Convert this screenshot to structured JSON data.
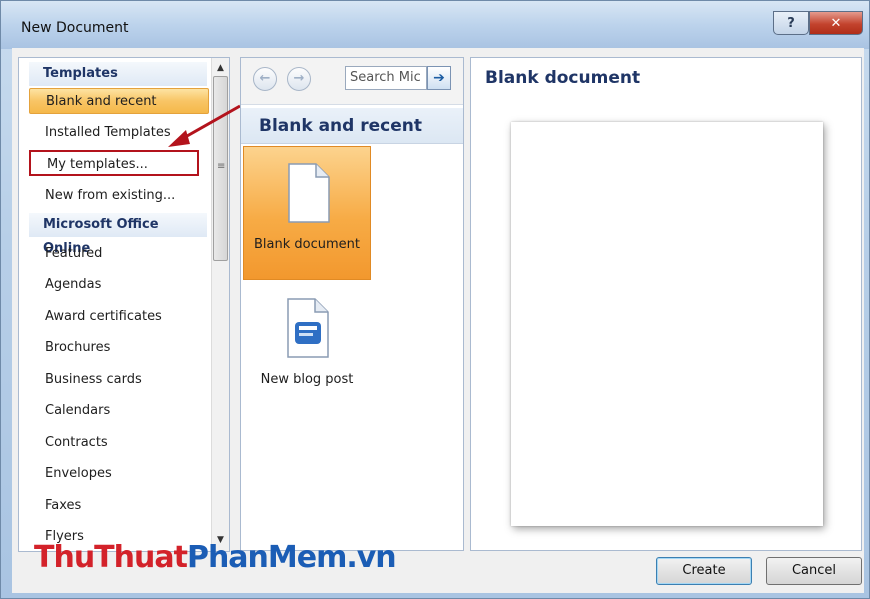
{
  "window": {
    "title": "New Document",
    "help_label": "?",
    "close_label": "✕"
  },
  "left_pane": {
    "section_templates": "Templates",
    "templates_items": [
      {
        "label": "Blank and recent",
        "selected": true
      },
      {
        "label": "Installed Templates"
      },
      {
        "label": "My templates..."
      },
      {
        "label": "New from existing..."
      }
    ],
    "section_online": "Microsoft Office Online",
    "online_items": [
      "Featured",
      "Agendas",
      "Award certificates",
      "Brochures",
      "Business cards",
      "Calendars",
      "Contracts",
      "Envelopes",
      "Faxes",
      "Flyers"
    ]
  },
  "middle_pane": {
    "search_placeholder": "Search Mic",
    "header": "Blank and recent",
    "tiles": [
      {
        "label": "Blank document",
        "icon": "blank-document-icon",
        "selected": true
      },
      {
        "label": "New blog post",
        "icon": "blog-post-icon"
      }
    ]
  },
  "right_pane": {
    "title": "Blank document"
  },
  "buttons": {
    "create": "Create",
    "cancel": "Cancel"
  },
  "watermark": {
    "part1": "ThuThuat",
    "part2": "PhanMem",
    "part3": ".vn"
  },
  "colors": {
    "selection": "#f7ab45",
    "annotation": "#b3131c",
    "heading": "#1f3566"
  }
}
